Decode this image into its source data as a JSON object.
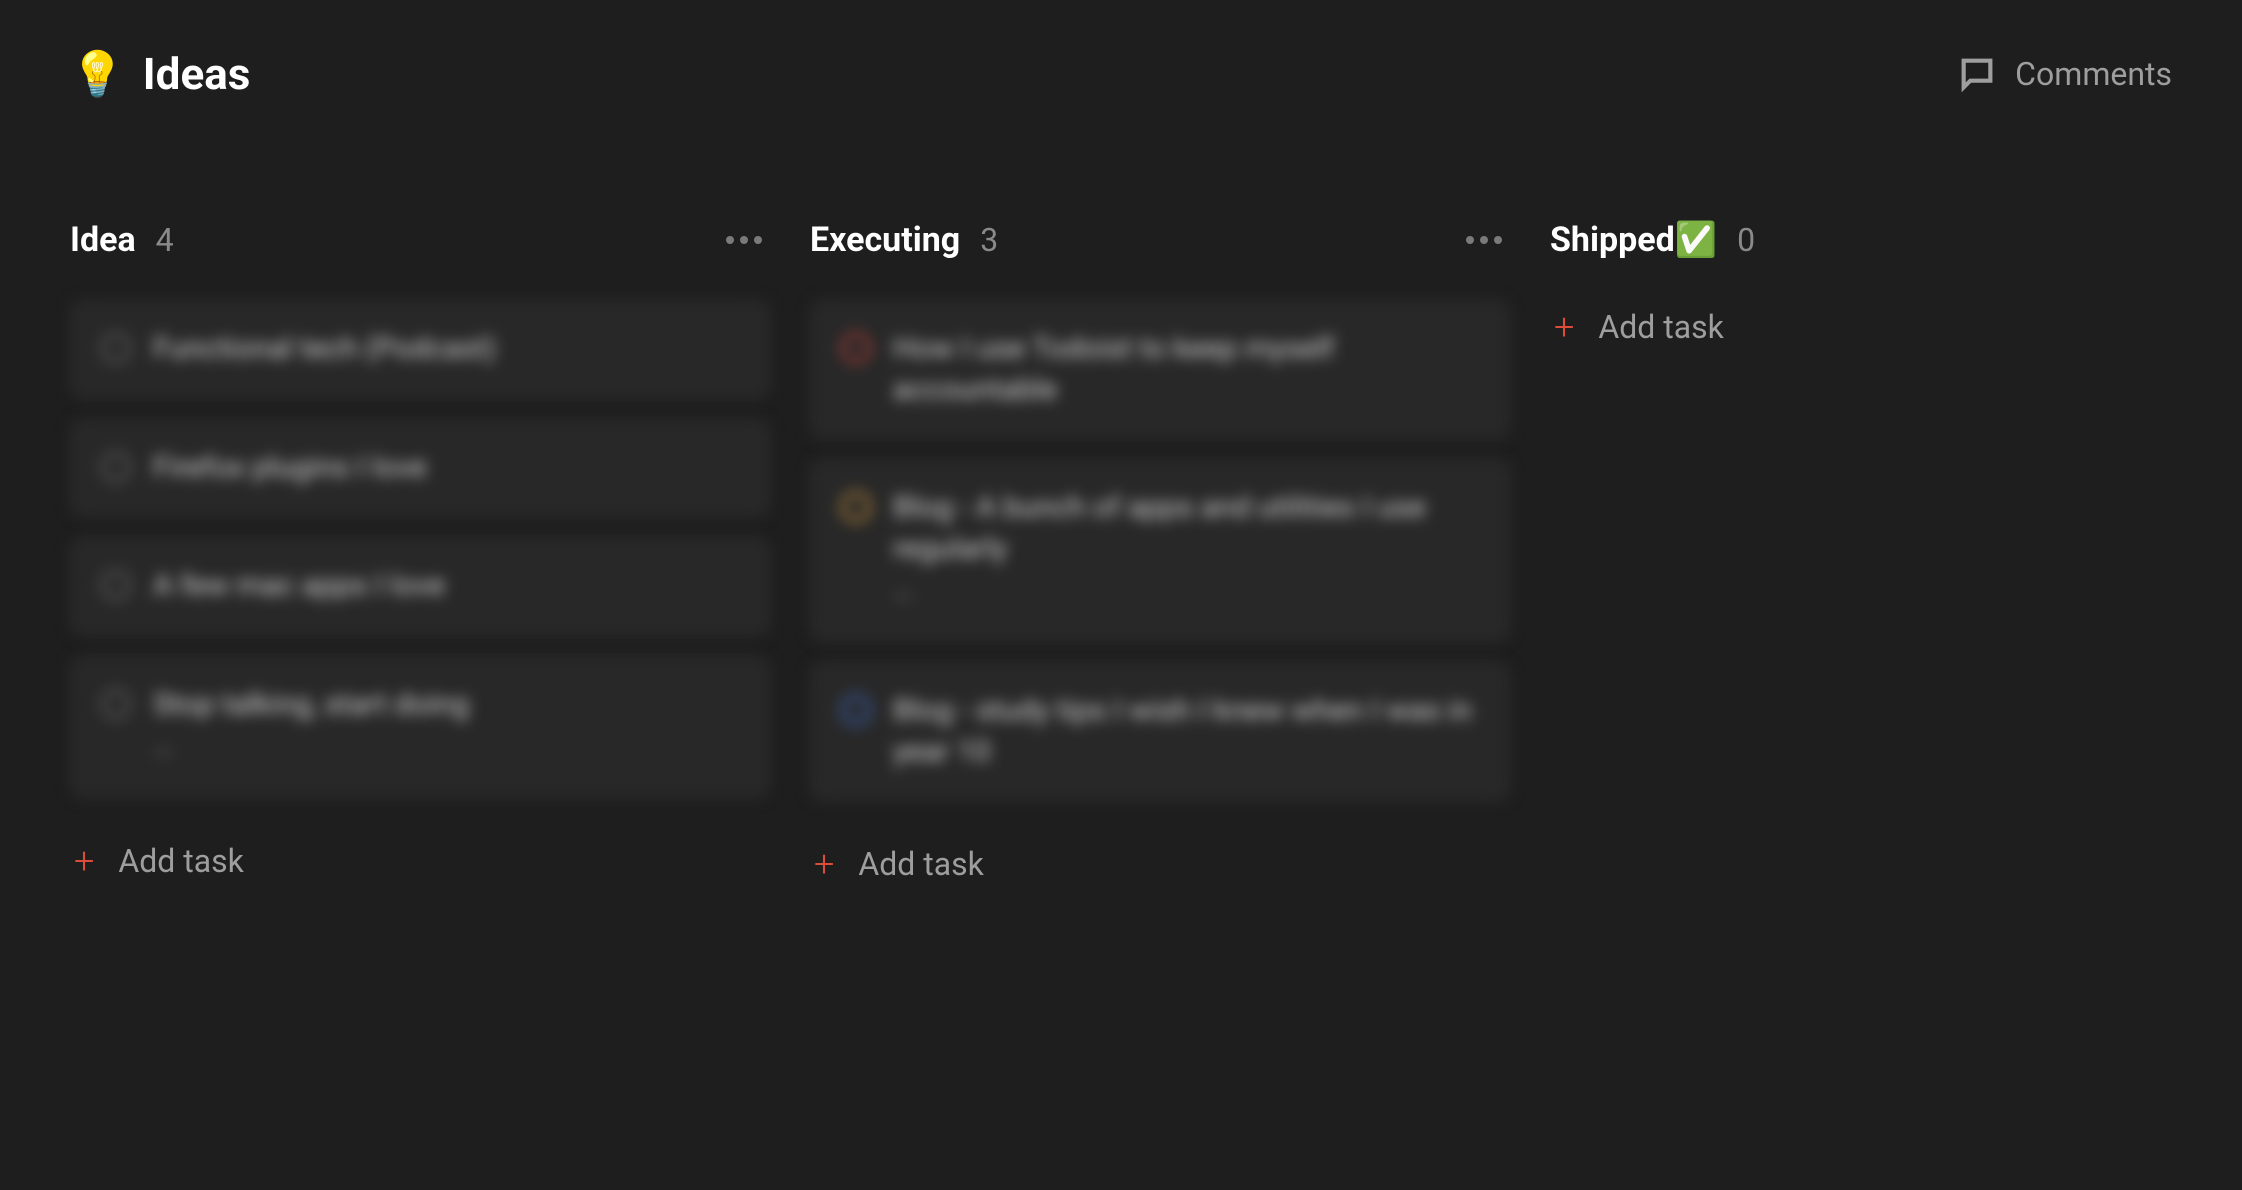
{
  "header": {
    "icon": "💡",
    "title": "Ideas",
    "comments_label": "Comments"
  },
  "add_task_label": "Add task",
  "columns": [
    {
      "id": "idea",
      "title": "Idea",
      "count": "4",
      "cards": [
        {
          "title": "Functional tech (Podcast)",
          "priority": "none",
          "meta": ""
        },
        {
          "title": "Firefox plugins I love",
          "priority": "none",
          "meta": ""
        },
        {
          "title": "A few mac apps I love",
          "priority": "none",
          "meta": ""
        },
        {
          "title": "Stop talking, start doing",
          "priority": "none",
          "meta": "—"
        }
      ]
    },
    {
      "id": "executing",
      "title": "Executing",
      "count": "3",
      "cards": [
        {
          "title": "How I use Todoist to keep myself accountable",
          "priority": "p1",
          "meta": ""
        },
        {
          "title": "Blog - A bunch of apps and utilities I use regularly",
          "priority": "p2",
          "meta": "—"
        },
        {
          "title": "Blog - study tips I wish I knew when I was in year 10",
          "priority": "p3",
          "meta": ""
        }
      ]
    },
    {
      "id": "shipped",
      "title": "Shipped✅",
      "count": "0",
      "cards": []
    }
  ]
}
